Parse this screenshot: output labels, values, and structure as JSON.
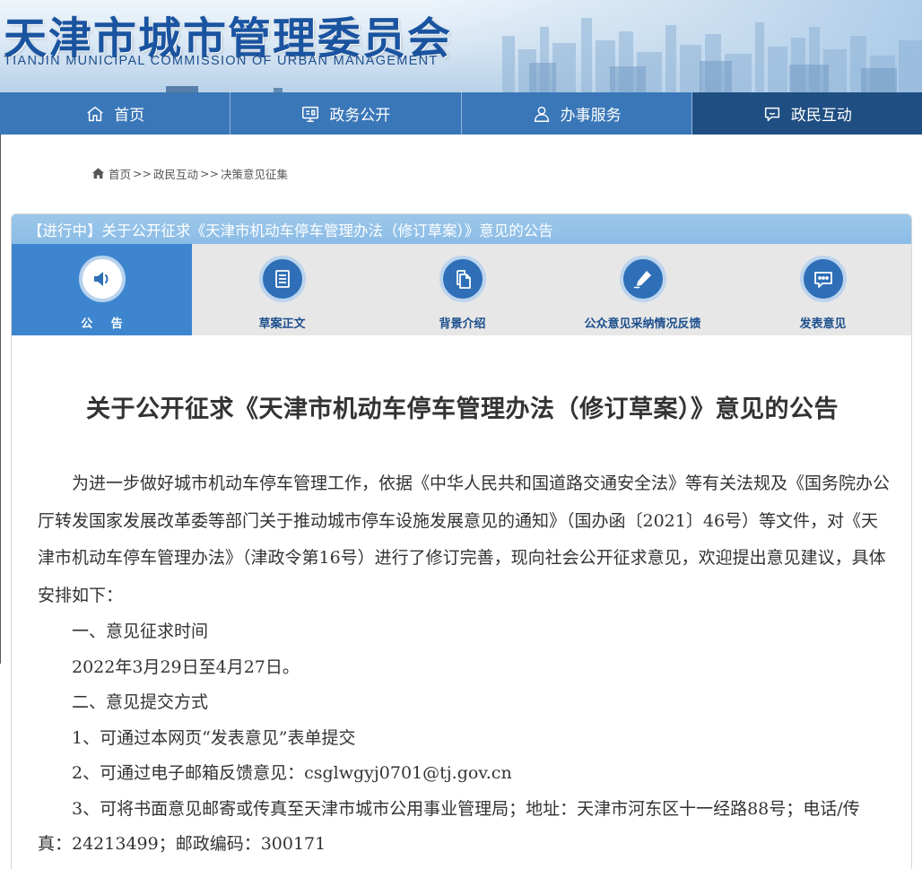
{
  "site": {
    "title_cn": "天津市城市管理委员会",
    "title_en": "TIANJIN MUNICIPAL COMMISSION OF URBAN MANAGEMENT"
  },
  "nav": {
    "items": [
      {
        "label": "首页",
        "icon": "home-icon"
      },
      {
        "label": "政务公开",
        "icon": "government-affairs-icon"
      },
      {
        "label": "办事服务",
        "icon": "user-service-icon"
      },
      {
        "label": "政民互动",
        "icon": "chat-bubble-icon"
      }
    ],
    "active_index": 3
  },
  "breadcrumb": {
    "home": "首页",
    "sep": ">>",
    "level1": "政民互动",
    "level2": "决策意见征集"
  },
  "panel": {
    "header": "【进行中】关于公开征求《天津市机动车停车管理办法（修订草案）》意见的公告",
    "tabs": [
      {
        "label": "公 告",
        "icon": "speaker-icon"
      },
      {
        "label": "草案正文",
        "icon": "document-icon"
      },
      {
        "label": "背景介绍",
        "icon": "files-icon"
      },
      {
        "label": "公众意见采纳情况反馈",
        "icon": "pen-icon"
      },
      {
        "label": "发表意见",
        "icon": "comment-icon"
      }
    ],
    "active_tab": 0
  },
  "article": {
    "title": "关于公开征求《天津市机动车停车管理办法（修订草案）》意见的公告",
    "para1": "为进一步做好城市机动车停车管理工作，依据《中华人民共和国道路交通安全法》等有关法规及《国务院办公厅转发国家发展改革委等部门关于推动城市停车设施发展意见的通知》（国办函〔2021〕46号）等文件，对《天津市机动车停车管理办法》（津政令第16号）进行了修订完善，现向社会公开征求意见，欢迎提出意见建议，具体安排如下：",
    "section1": "一、意见征求时间",
    "time": "2022年3月29日至4月27日。",
    "section2": "二、意见提交方式",
    "method1": "1、可通过本网页“发表意见”表单提交",
    "method2": "2、可通过电子邮箱反馈意见：csglwgyj0701@tj.gov.cn",
    "method3": "3、可将书面意见邮寄或传真至天津市城市公用事业管理局；地址：天津市河东区十一经路88号；电话/传真：24213499；邮政编码：300171"
  },
  "colors": {
    "nav_bg": "#3a77b8",
    "nav_active": "#1f4f82",
    "panel_header": "#8bbce6",
    "tab_active": "#3d86cf",
    "tab_icon": "#2e6fb7",
    "title_blue": "#1a54a0"
  }
}
